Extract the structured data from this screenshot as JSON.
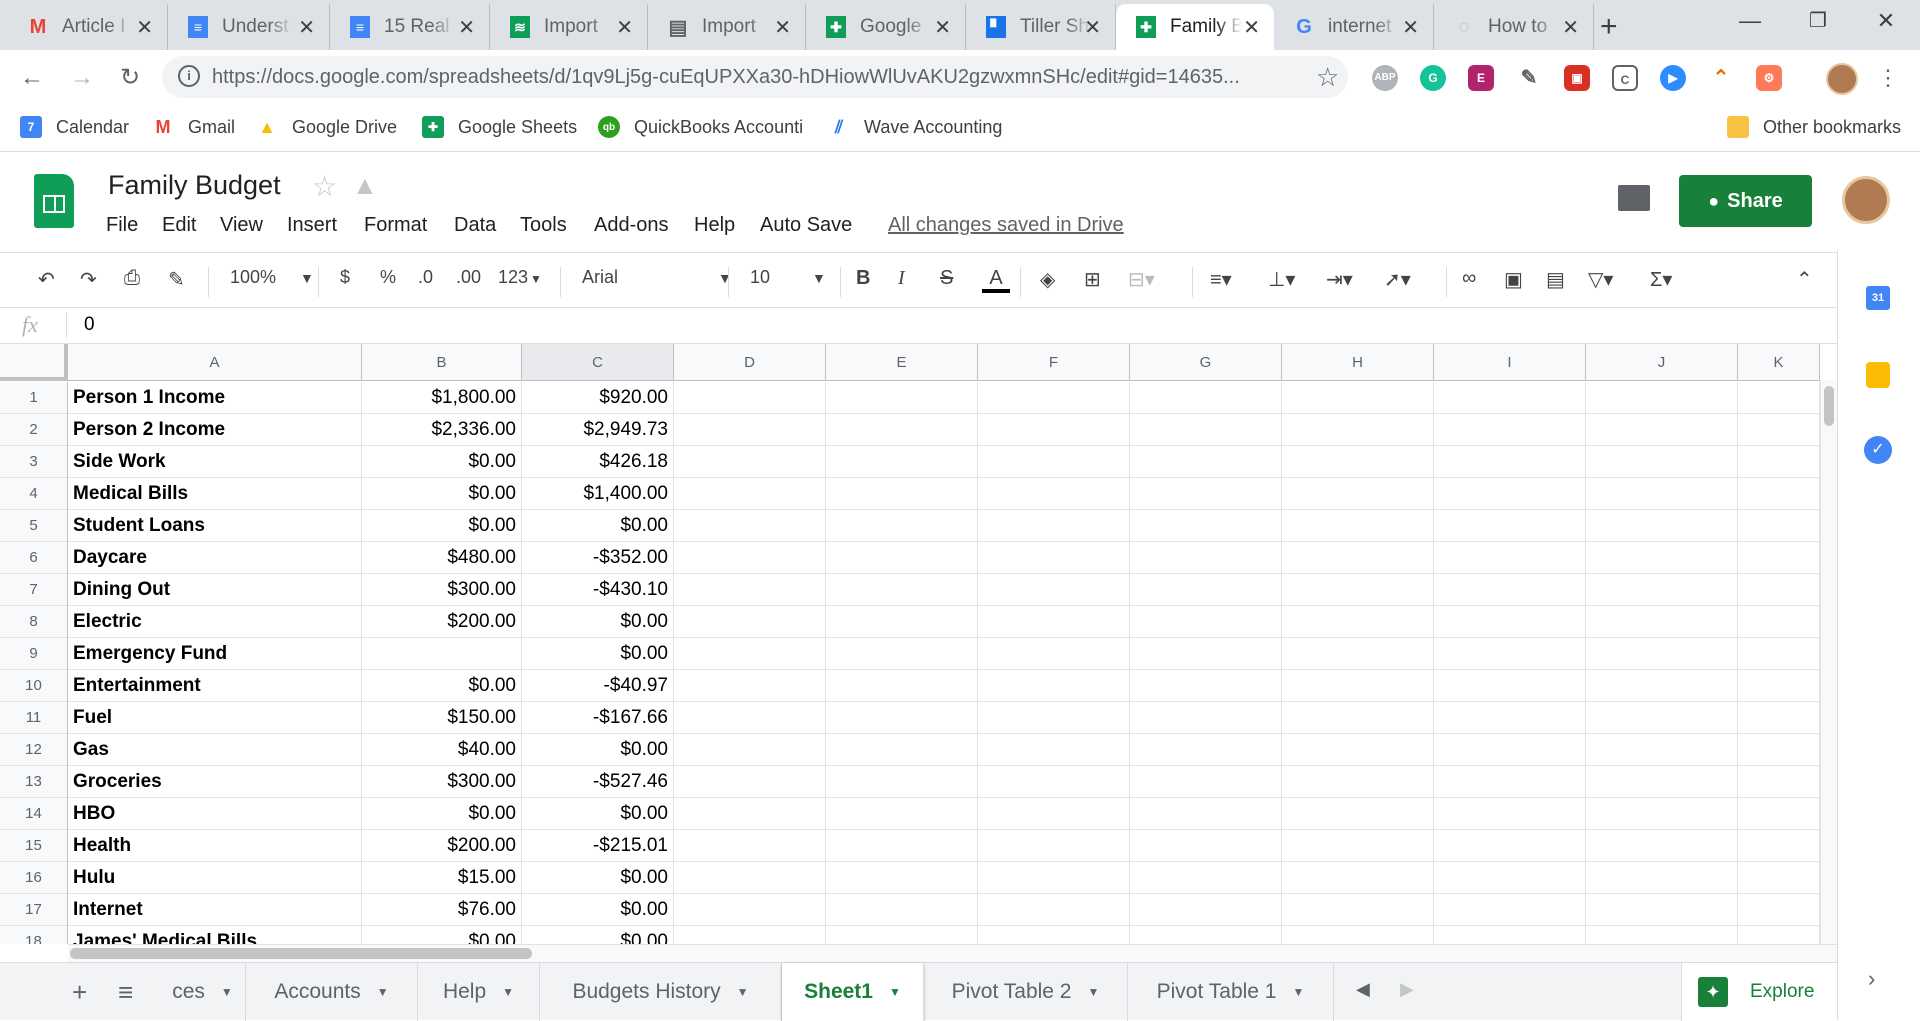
{
  "browser": {
    "tabs": [
      {
        "label": "Article I",
        "icon": "gmail-icon",
        "active": false
      },
      {
        "label": "Underst",
        "icon": "docs-icon",
        "active": false
      },
      {
        "label": "15 Real",
        "icon": "docs-icon",
        "active": false
      },
      {
        "label": "Import",
        "icon": "db-icon",
        "active": false
      },
      {
        "label": "Import",
        "icon": "book-icon",
        "active": false
      },
      {
        "label": "Google",
        "icon": "sheets-icon",
        "active": false
      },
      {
        "label": "Tiller Sh",
        "icon": "tiller-icon",
        "active": false
      },
      {
        "label": "Family B",
        "icon": "sheets-icon",
        "active": true
      },
      {
        "label": "internet",
        "icon": "google-icon",
        "active": false
      },
      {
        "label": "How to",
        "icon": "loading-icon",
        "active": false
      }
    ],
    "url": "https://docs.google.com/spreadsheets/d/1qv9Lj5g-cuEqUPXXa30-hDHiowWlUvAKU2gzwxmnSHc/edit#gid=14635...",
    "extensions": [
      "ABP",
      "G",
      "E",
      "",
      "",
      "C",
      "",
      "",
      "",
      ""
    ],
    "bookmarks": [
      {
        "label": "Calendar",
        "icon": "calendar-icon"
      },
      {
        "label": "Gmail",
        "icon": "gmail-icon"
      },
      {
        "label": "Google Drive",
        "icon": "drive-icon"
      },
      {
        "label": "Google Sheets",
        "icon": "sheets-icon"
      },
      {
        "label": "QuickBooks Accounti",
        "icon": "quickbooks-icon"
      },
      {
        "label": "Wave Accounting",
        "icon": "wave-icon"
      }
    ],
    "other_bookmarks": "Other bookmarks",
    "calendar_day": "7"
  },
  "sheets": {
    "title": "Family Budget",
    "menus": [
      "File",
      "Edit",
      "View",
      "Insert",
      "Format",
      "Data",
      "Tools",
      "Add-ons",
      "Help",
      "Auto Save"
    ],
    "save_status": "All changes saved in Drive",
    "share_label": "Share",
    "toolbar": {
      "zoom": "100%",
      "currency": "$",
      "percent": "%",
      "dec_less": ".0",
      "dec_more": ".00",
      "more_formats": "123",
      "font": "Arial",
      "font_size": "10",
      "bold": "B",
      "italic": "I",
      "strike": "S",
      "text_color": "A"
    },
    "fx_label": "fx",
    "formula_value": "0",
    "columns": [
      "A",
      "B",
      "C",
      "D",
      "E",
      "F",
      "G",
      "H",
      "I",
      "J",
      "K"
    ],
    "rows": [
      {
        "n": "1",
        "a": "Person 1 Income",
        "b": "$1,800.00",
        "c": "$920.00"
      },
      {
        "n": "2",
        "a": "Person 2 Income",
        "b": "$2,336.00",
        "c": "$2,949.73"
      },
      {
        "n": "3",
        "a": "Side Work",
        "b": "$0.00",
        "c": "$426.18"
      },
      {
        "n": "4",
        "a": "Medical Bills",
        "b": "$0.00",
        "c": "$1,400.00"
      },
      {
        "n": "5",
        "a": "Student Loans",
        "b": "$0.00",
        "c": "$0.00"
      },
      {
        "n": "6",
        "a": "Daycare",
        "b": "$480.00",
        "c": "-$352.00"
      },
      {
        "n": "7",
        "a": "Dining Out",
        "b": "$300.00",
        "c": "-$430.10"
      },
      {
        "n": "8",
        "a": "Electric",
        "b": "$200.00",
        "c": "$0.00"
      },
      {
        "n": "9",
        "a": "Emergency Fund",
        "b": "",
        "c": "$0.00"
      },
      {
        "n": "10",
        "a": "Entertainment",
        "b": "$0.00",
        "c": "-$40.97"
      },
      {
        "n": "11",
        "a": "Fuel",
        "b": "$150.00",
        "c": "-$167.66"
      },
      {
        "n": "12",
        "a": "Gas",
        "b": "$40.00",
        "c": "$0.00"
      },
      {
        "n": "13",
        "a": "Groceries",
        "b": "$300.00",
        "c": "-$527.46"
      },
      {
        "n": "14",
        "a": "HBO",
        "b": "$0.00",
        "c": "$0.00"
      },
      {
        "n": "15",
        "a": "Health",
        "b": "$200.00",
        "c": "-$215.01"
      },
      {
        "n": "16",
        "a": "Hulu",
        "b": "$15.00",
        "c": "$0.00"
      },
      {
        "n": "17",
        "a": "Internet",
        "b": "$76.00",
        "c": "$0.00"
      },
      {
        "n": "18",
        "a": "James' Medical Bills",
        "b": "$0.00",
        "c": "$0.00"
      }
    ],
    "sheet_tabs": [
      {
        "label": "ces",
        "active": false
      },
      {
        "label": "Accounts",
        "active": false
      },
      {
        "label": "Help",
        "active": false
      },
      {
        "label": "Budgets History",
        "active": false
      },
      {
        "label": "Sheet1",
        "active": true
      },
      {
        "label": "Pivot Table 2",
        "active": false
      },
      {
        "label": "Pivot Table 1",
        "active": false
      }
    ],
    "explore_label": "Explore",
    "side_calendar_day": "31"
  },
  "colors": {
    "sheets_green": "#188038",
    "chrome_tabstrip": "#dee1e6",
    "gmail_red": "#ea4335",
    "docs_blue": "#4285f4"
  }
}
